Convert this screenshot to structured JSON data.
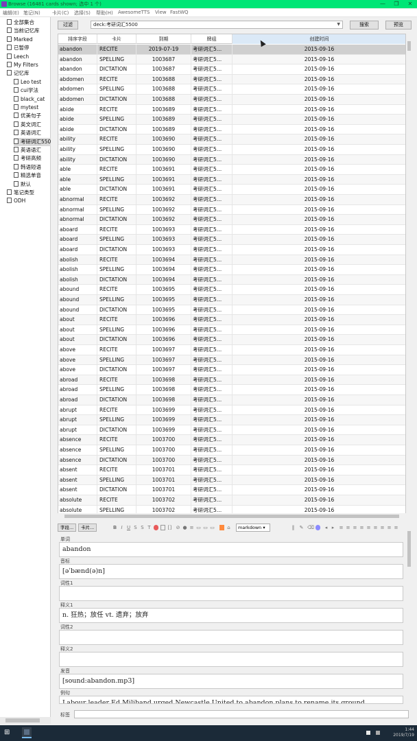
{
  "window": {
    "title": "Browse (16481 cards shown; 选中 1 个)",
    "controls": [
      "—",
      "❐",
      "✕"
    ]
  },
  "menu": [
    "编辑(E)",
    "笔记(N)",
    "卡片(C)",
    "选择(S)",
    "帮助(H)",
    "AwesomeTTS",
    "View",
    "FastWQ"
  ],
  "sidebar": {
    "items": [
      {
        "label": "全部集合",
        "indent": 0
      },
      {
        "label": "当前记忆库",
        "indent": 0
      },
      {
        "label": "Marked",
        "indent": 0
      },
      {
        "label": "已暂停",
        "indent": 0
      },
      {
        "label": "Leech",
        "indent": 0
      },
      {
        "label": "My Filters",
        "indent": 0
      },
      {
        "label": "记忆库",
        "indent": 0,
        "arrow": true
      },
      {
        "label": "Leo test",
        "indent": 1,
        "arrow": true
      },
      {
        "label": "cui学法",
        "indent": 1
      },
      {
        "label": "black_cat",
        "indent": 1
      },
      {
        "label": "mytest",
        "indent": 1
      },
      {
        "label": "优美句子",
        "indent": 1
      },
      {
        "label": "英文词汇",
        "indent": 1
      },
      {
        "label": "英语词汇",
        "indent": 1
      },
      {
        "label": "考研词汇5500",
        "indent": 1,
        "arrow": true,
        "selected": true
      },
      {
        "label": "英语语汇",
        "indent": 1
      },
      {
        "label": "考研高频",
        "indent": 1
      },
      {
        "label": "韩语短语",
        "indent": 1
      },
      {
        "label": "精选单音",
        "indent": 1
      },
      {
        "label": "默认",
        "indent": 1
      },
      {
        "label": "笔记类型",
        "indent": 0,
        "arrow": true
      },
      {
        "label": "ODH",
        "indent": 0
      }
    ]
  },
  "toolbar": {
    "filter_label": "过滤",
    "search_value": "deck:考研词汇5500",
    "search_button": "搜索",
    "preview_button": "预览"
  },
  "table": {
    "columns": [
      "排序字段",
      "卡片",
      "到期",
      "牌组",
      "创建时间"
    ],
    "rows": [
      [
        "abandon",
        "RECITE",
        "2019-07-19",
        "考研词汇5…",
        "2015-09-16"
      ],
      [
        "abandon",
        "SPELLING",
        "1003687",
        "考研词汇5…",
        "2015-09-16"
      ],
      [
        "abandon",
        "DICTATION",
        "1003687",
        "考研词汇5…",
        "2015-09-16"
      ],
      [
        "abdomen",
        "RECITE",
        "1003688",
        "考研词汇5…",
        "2015-09-16"
      ],
      [
        "abdomen",
        "SPELLING",
        "1003688",
        "考研词汇5…",
        "2015-09-16"
      ],
      [
        "abdomen",
        "DICTATION",
        "1003688",
        "考研词汇5…",
        "2015-09-16"
      ],
      [
        "abide",
        "RECITE",
        "1003689",
        "考研词汇5…",
        "2015-09-16"
      ],
      [
        "abide",
        "SPELLING",
        "1003689",
        "考研词汇5…",
        "2015-09-16"
      ],
      [
        "abide",
        "DICTATION",
        "1003689",
        "考研词汇5…",
        "2015-09-16"
      ],
      [
        "ability",
        "RECITE",
        "1003690",
        "考研词汇5…",
        "2015-09-16"
      ],
      [
        "ability",
        "SPELLING",
        "1003690",
        "考研词汇5…",
        "2015-09-16"
      ],
      [
        "ability",
        "DICTATION",
        "1003690",
        "考研词汇5…",
        "2015-09-16"
      ],
      [
        "able",
        "RECITE",
        "1003691",
        "考研词汇5…",
        "2015-09-16"
      ],
      [
        "able",
        "SPELLING",
        "1003691",
        "考研词汇5…",
        "2015-09-16"
      ],
      [
        "able",
        "DICTATION",
        "1003691",
        "考研词汇5…",
        "2015-09-16"
      ],
      [
        "abnormal",
        "RECITE",
        "1003692",
        "考研词汇5…",
        "2015-09-16"
      ],
      [
        "abnormal",
        "SPELLING",
        "1003692",
        "考研词汇5…",
        "2015-09-16"
      ],
      [
        "abnormal",
        "DICTATION",
        "1003692",
        "考研词汇5…",
        "2015-09-16"
      ],
      [
        "aboard",
        "RECITE",
        "1003693",
        "考研词汇5…",
        "2015-09-16"
      ],
      [
        "aboard",
        "SPELLING",
        "1003693",
        "考研词汇5…",
        "2015-09-16"
      ],
      [
        "aboard",
        "DICTATION",
        "1003693",
        "考研词汇5…",
        "2015-09-16"
      ],
      [
        "abolish",
        "RECITE",
        "1003694",
        "考研词汇5…",
        "2015-09-16"
      ],
      [
        "abolish",
        "SPELLING",
        "1003694",
        "考研词汇5…",
        "2015-09-16"
      ],
      [
        "abolish",
        "DICTATION",
        "1003694",
        "考研词汇5…",
        "2015-09-16"
      ],
      [
        "abound",
        "RECITE",
        "1003695",
        "考研词汇5…",
        "2015-09-16"
      ],
      [
        "abound",
        "SPELLING",
        "1003695",
        "考研词汇5…",
        "2015-09-16"
      ],
      [
        "abound",
        "DICTATION",
        "1003695",
        "考研词汇5…",
        "2015-09-16"
      ],
      [
        "about",
        "RECITE",
        "1003696",
        "考研词汇5…",
        "2015-09-16"
      ],
      [
        "about",
        "SPELLING",
        "1003696",
        "考研词汇5…",
        "2015-09-16"
      ],
      [
        "about",
        "DICTATION",
        "1003696",
        "考研词汇5…",
        "2015-09-16"
      ],
      [
        "above",
        "RECITE",
        "1003697",
        "考研词汇5…",
        "2015-09-16"
      ],
      [
        "above",
        "SPELLING",
        "1003697",
        "考研词汇5…",
        "2015-09-16"
      ],
      [
        "above",
        "DICTATION",
        "1003697",
        "考研词汇5…",
        "2015-09-16"
      ],
      [
        "abroad",
        "RECITE",
        "1003698",
        "考研词汇5…",
        "2015-09-16"
      ],
      [
        "abroad",
        "SPELLING",
        "1003698",
        "考研词汇5…",
        "2015-09-16"
      ],
      [
        "abroad",
        "DICTATION",
        "1003698",
        "考研词汇5…",
        "2015-09-16"
      ],
      [
        "abrupt",
        "RECITE",
        "1003699",
        "考研词汇5…",
        "2015-09-16"
      ],
      [
        "abrupt",
        "SPELLING",
        "1003699",
        "考研词汇5…",
        "2015-09-16"
      ],
      [
        "abrupt",
        "DICTATION",
        "1003699",
        "考研词汇5…",
        "2015-09-16"
      ],
      [
        "absence",
        "RECITE",
        "1003700",
        "考研词汇5…",
        "2015-09-16"
      ],
      [
        "absence",
        "SPELLING",
        "1003700",
        "考研词汇5…",
        "2015-09-16"
      ],
      [
        "absence",
        "DICTATION",
        "1003700",
        "考研词汇5…",
        "2015-09-16"
      ],
      [
        "absent",
        "RECITE",
        "1003701",
        "考研词汇5…",
        "2015-09-16"
      ],
      [
        "absent",
        "SPELLING",
        "1003701",
        "考研词汇5…",
        "2015-09-16"
      ],
      [
        "absent",
        "DICTATION",
        "1003701",
        "考研词汇5…",
        "2015-09-16"
      ],
      [
        "absolute",
        "RECITE",
        "1003702",
        "考研词汇5…",
        "2015-09-16"
      ],
      [
        "absolute",
        "SPELLING",
        "1003702",
        "考研词汇5…",
        "2015-09-16"
      ]
    ]
  },
  "editor": {
    "fields_button": "字段...",
    "cards_button": "卡片...",
    "format": "markdown",
    "fields": [
      {
        "name": "单词",
        "value": "abandon"
      },
      {
        "name": "音标",
        "value": "[əˈbænd(ə)n]"
      },
      {
        "name": "词性1",
        "value": ""
      },
      {
        "name": "释义1",
        "value": "n. 狂热；放任 vt. 遗弃；放弃"
      },
      {
        "name": "词性2",
        "value": ""
      },
      {
        "name": "释义2",
        "value": ""
      },
      {
        "name": "发音",
        "value": "[sound:abandon.mp3]"
      },
      {
        "name": "例句",
        "value": "Labour leader Ed Miliband urged Newcastle United to abandon plans to rename its ground."
      }
    ],
    "tags_label": "标签"
  },
  "taskbar": {
    "time": "1:44",
    "date": "2019/7/19"
  }
}
